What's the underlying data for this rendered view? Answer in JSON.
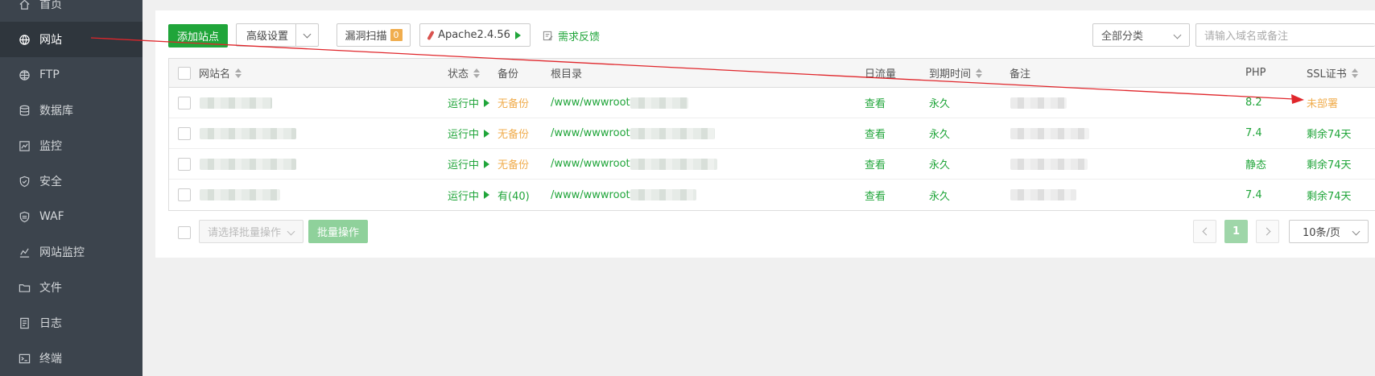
{
  "sidebar": {
    "items": [
      {
        "label": "首页",
        "icon": "home-icon",
        "active": false
      },
      {
        "label": "网站",
        "icon": "globe-icon",
        "active": true
      },
      {
        "label": "FTP",
        "icon": "ftp-globe-icon",
        "active": false
      },
      {
        "label": "数据库",
        "icon": "database-icon",
        "active": false
      },
      {
        "label": "监控",
        "icon": "monitor-chart-icon",
        "active": false
      },
      {
        "label": "安全",
        "icon": "shield-icon",
        "active": false
      },
      {
        "label": "WAF",
        "icon": "waf-shield-icon",
        "active": false
      },
      {
        "label": "网站监控",
        "icon": "line-chart-icon",
        "active": false
      },
      {
        "label": "文件",
        "icon": "folder-icon",
        "active": false
      },
      {
        "label": "日志",
        "icon": "log-icon",
        "active": false
      },
      {
        "label": "终端",
        "icon": "terminal-icon",
        "active": false
      }
    ]
  },
  "toolbar": {
    "add_site": "添加站点",
    "advanced": "高级设置",
    "vuln_scan": "漏洞扫描",
    "vuln_count": "0",
    "apache": "Apache2.4.56",
    "feedback": "需求反馈",
    "category": "全部分类",
    "search_placeholder": "请输入域名或备注"
  },
  "table": {
    "headers": {
      "name": "网站名",
      "status": "状态",
      "backup": "备份",
      "root": "根目录",
      "traffic": "日流量",
      "expire": "到期时间",
      "remark": "备注",
      "php": "PHP",
      "ssl": "SSL证书"
    },
    "rows": [
      {
        "status": "运行中",
        "backup": "无备份",
        "root": "/www/wwwroot",
        "traffic": "查看",
        "expire": "永久",
        "php": "8.2",
        "ssl": "未部署"
      },
      {
        "status": "运行中",
        "backup": "无备份",
        "root": "/www/wwwroot",
        "traffic": "查看",
        "expire": "永久",
        "php": "7.4",
        "ssl": "剩余74天"
      },
      {
        "status": "运行中",
        "backup": "无备份",
        "root": "/www/wwwroot",
        "traffic": "查看",
        "expire": "永久",
        "php": "静态",
        "ssl": "剩余74天"
      },
      {
        "status": "运行中",
        "backup": "有(40)",
        "root": "/www/wwwroot",
        "traffic": "查看",
        "expire": "永久",
        "php": "7.4",
        "ssl": "剩余74天"
      }
    ]
  },
  "footer": {
    "batch_placeholder": "请选择批量操作",
    "batch_button": "批量操作",
    "current_page": "1",
    "page_size": "10条/页"
  },
  "colors": {
    "accent": "#20a53a",
    "warning": "#f0ad4e",
    "annotation": "#e0262b",
    "sidebar_bg": "#3c444d"
  }
}
